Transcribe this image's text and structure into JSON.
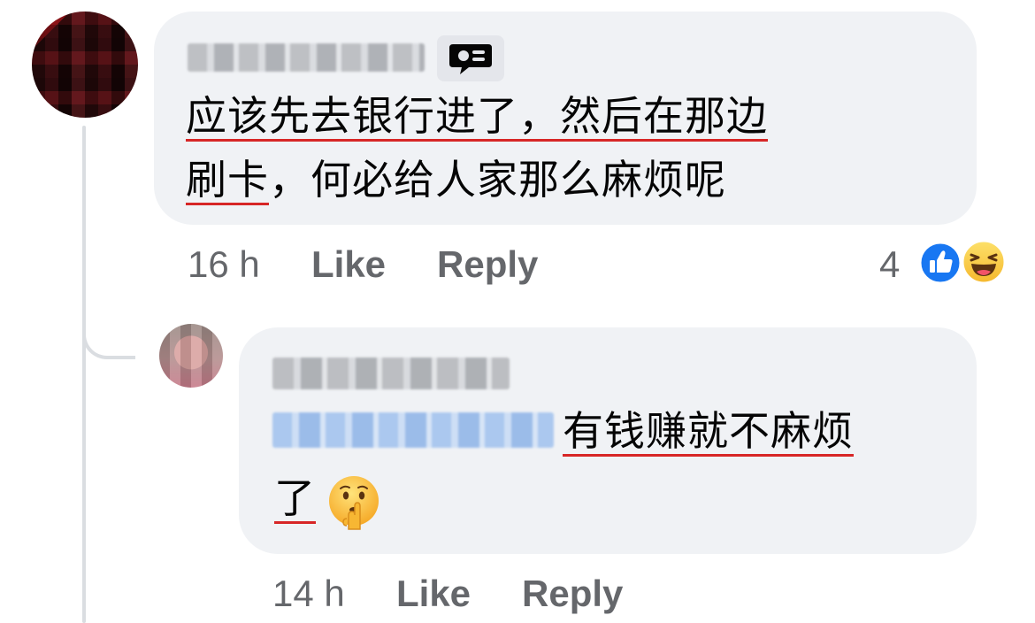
{
  "comments": [
    {
      "text_line1": "应该先去银行进了，然后在那边",
      "text_line2_ul": "刷卡",
      "text_line2_rest": "，何必给人家那么麻烦呢",
      "time": "16 h",
      "like_label": "Like",
      "reply_label": "Reply",
      "reaction_count": "4",
      "reactions": [
        "like-icon",
        "haha-icon"
      ]
    },
    {
      "text_line1": "有钱赚就不麻烦",
      "text_line2": "了",
      "emoji": "shushing-face-icon",
      "time": "14 h",
      "like_label": "Like",
      "reply_label": "Reply"
    }
  ],
  "colors": {
    "bubble": "#f0f2f5",
    "meta_text": "#65676b",
    "underline": "#d72626",
    "like_blue": "#1877f2"
  }
}
